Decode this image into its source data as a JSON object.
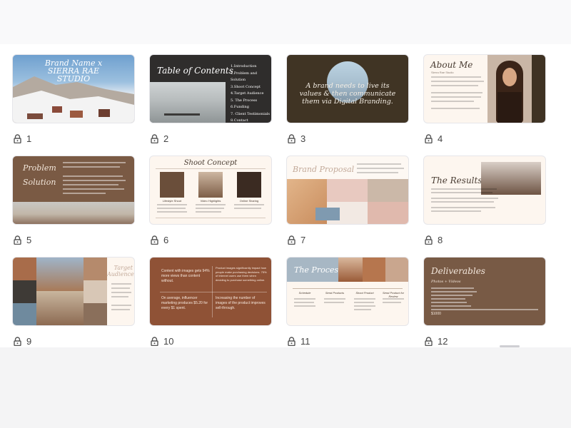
{
  "slides": [
    {
      "number": "1",
      "title_line1": "Brand Name x",
      "title_line2": "SIERRA RAE",
      "title_line3": "STUDIO"
    },
    {
      "number": "2",
      "title": "Table of Contents",
      "toc": [
        "1.Introduction",
        "2.Problem and Solution",
        "3.Shoot Concept",
        "4.Target Audience",
        "5. The Process",
        "6.Funding",
        "7. Client Testimonials",
        "8.Contact"
      ]
    },
    {
      "number": "3",
      "quote": "A brand needs to live its values & then communicate them via Digital Branding."
    },
    {
      "number": "4",
      "title": "About Me",
      "subtitle": "Sierra Rae Studio"
    },
    {
      "number": "5",
      "title_line1": "Problem",
      "title_line2": "Solution"
    },
    {
      "number": "6",
      "title": "Shoot Concept",
      "cols": [
        "Lifestyle Shoot",
        "Video Highlights",
        "Online Sharing"
      ]
    },
    {
      "number": "7",
      "title": "Brand Proposal"
    },
    {
      "number": "8",
      "title": "The Results:"
    },
    {
      "number": "9",
      "title_line1": "Target",
      "title_line2": "Audience"
    },
    {
      "number": "10",
      "text_a": "Content with images gets 94% more views than content without.",
      "text_b": "On average, influencer marketing produces $5.20 for every $1 spent.",
      "text_c": "Product images significantly impact how people make purchasing decisions. 75% of internet users use them when deciding to purchase something online.",
      "text_d": "Increasing the number of images of the product improves sell-through."
    },
    {
      "number": "11",
      "title": "The Process",
      "steps": [
        "Schedule",
        "Send Products",
        "Shoot Product",
        "Send Product for Review"
      ]
    },
    {
      "number": "12",
      "title": "Deliverables",
      "subtitle": "Photos + Videos",
      "price": "$1000"
    }
  ]
}
